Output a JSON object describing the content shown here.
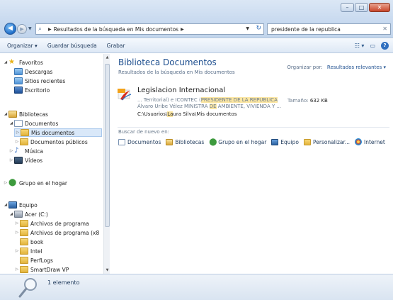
{
  "window": {
    "caption_min": "–",
    "caption_max": "□",
    "caption_close": "✕"
  },
  "address": {
    "breadcrumb": "Resultados de la búsqueda en Mis documentos"
  },
  "search": {
    "value": "presidente de la republica"
  },
  "commandbar": {
    "organize": "Organizar ▾",
    "save_search": "Guardar búsqueda",
    "burn": "Grabar"
  },
  "nav": {
    "items": [
      {
        "label": "Favoritos"
      },
      {
        "label": "Descargas"
      },
      {
        "label": "Sitios recientes"
      },
      {
        "label": "Escritorio"
      },
      {
        "label": "Bibliotecas"
      },
      {
        "label": "Documentos"
      },
      {
        "label": "Mis documentos"
      },
      {
        "label": "Documentos públicos"
      },
      {
        "label": "Música"
      },
      {
        "label": "Vídeos"
      },
      {
        "label": "Grupo en el hogar"
      },
      {
        "label": "Equipo"
      },
      {
        "label": "Acer (C:)"
      },
      {
        "label": "Archivos de programa"
      },
      {
        "label": "Archivos de programa (x8"
      },
      {
        "label": "book"
      },
      {
        "label": "Intel"
      },
      {
        "label": "PerfLogs"
      },
      {
        "label": "SmartDraw VP"
      }
    ]
  },
  "content": {
    "title": "Biblioteca Documentos",
    "subtitle": "Resultados de la búsqueda en Mis documentos",
    "arrange_label": "Organizar por:",
    "arrange_value": "Resultados relevantes ▾",
    "result": {
      "name": "Legislacion Internacional",
      "snippet1_pre": "... Territorial) e ICONTEC (",
      "snippet1_hl": "PRESIDENTE DE LA REPUBLICA",
      "snippet2_pre": "Álvaro Uribe Vélez MINISTRA ",
      "snippet2_hl": "DE",
      "snippet2_post": " AMBIENTE, VIVIENDA Y ...",
      "path_pre": "C:\\Usuarios\\",
      "path_hl": "La",
      "path_post": "ura Silva\\Mis documentos",
      "size_label": "Tamaño:",
      "size_value": "632 KB"
    },
    "search_again_label": "Buscar de nuevo en:",
    "search_again": [
      {
        "label": "Documentos"
      },
      {
        "label": "Bibliotecas"
      },
      {
        "label": "Grupo en el hogar"
      },
      {
        "label": "Equipo"
      },
      {
        "label": "Personalizar..."
      },
      {
        "label": "Internet"
      }
    ]
  },
  "details": {
    "count": "1 elemento"
  }
}
